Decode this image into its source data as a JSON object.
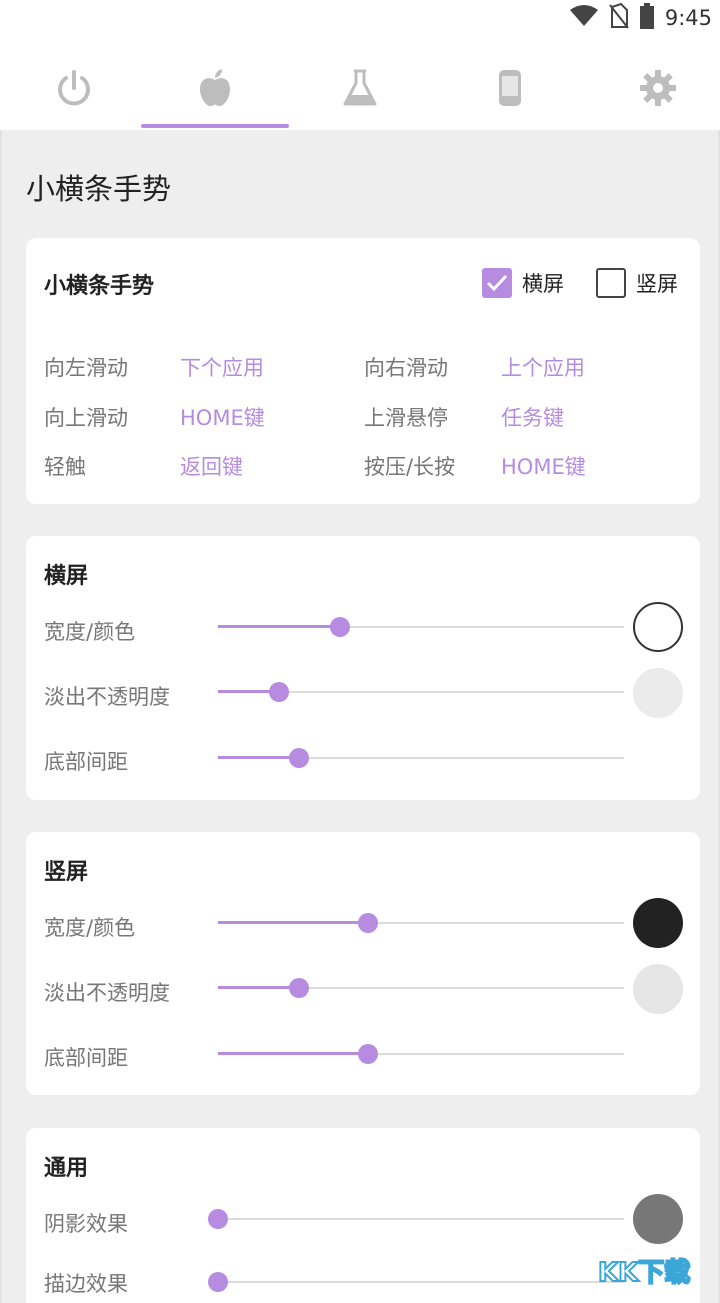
{
  "status_bar": {
    "time": "9:45",
    "icons": [
      "wifi-icon",
      "no-sim-icon",
      "battery-icon"
    ]
  },
  "tabs": [
    {
      "name": "power",
      "icon": "power-icon"
    },
    {
      "name": "apple",
      "icon": "apple-icon",
      "selected": true
    },
    {
      "name": "lab",
      "icon": "flask-icon"
    },
    {
      "name": "phone",
      "icon": "phone-icon"
    },
    {
      "name": "settings",
      "icon": "gear-icon"
    }
  ],
  "page_title": "小横条手势",
  "gesture_card": {
    "title": "小横条手势",
    "landscape_label": "横屏",
    "landscape_checked": true,
    "portrait_label": "竖屏",
    "portrait_checked": false,
    "mappings": [
      {
        "label": "向左滑动",
        "value": "下个应用"
      },
      {
        "label": "向右滑动",
        "value": "上个应用"
      },
      {
        "label": "向上滑动",
        "value": "HOME键"
      },
      {
        "label": "上滑悬停",
        "value": "任务键"
      },
      {
        "label": "轻触",
        "value": "返回键"
      },
      {
        "label": "按压/长按",
        "value": "HOME键"
      }
    ]
  },
  "landscape_card": {
    "title": "横屏",
    "rows": [
      {
        "label": "宽度/颜色",
        "value": 0.3,
        "swatch": "#ffffff"
      },
      {
        "label": "淡出不透明度",
        "value": 0.15,
        "swatch": "#ebebeb"
      },
      {
        "label": "底部间距",
        "value": 0.2
      }
    ]
  },
  "portrait_card": {
    "title": "竖屏",
    "rows": [
      {
        "label": "宽度/颜色",
        "value": 0.37,
        "swatch": "#222222"
      },
      {
        "label": "淡出不透明度",
        "value": 0.2,
        "swatch": "#e6e6e6"
      },
      {
        "label": "底部间距",
        "value": 0.37
      }
    ]
  },
  "general_card": {
    "title": "通用",
    "rows": [
      {
        "label": "阴影效果",
        "value": 0.0,
        "swatch": "#777777"
      },
      {
        "label": "描边效果",
        "value": 0.0
      }
    ]
  },
  "colors": {
    "accent": "#b68be0",
    "background": "#eeeeee",
    "icon_gray": "#bdbdbd"
  },
  "watermark": "KK下载"
}
